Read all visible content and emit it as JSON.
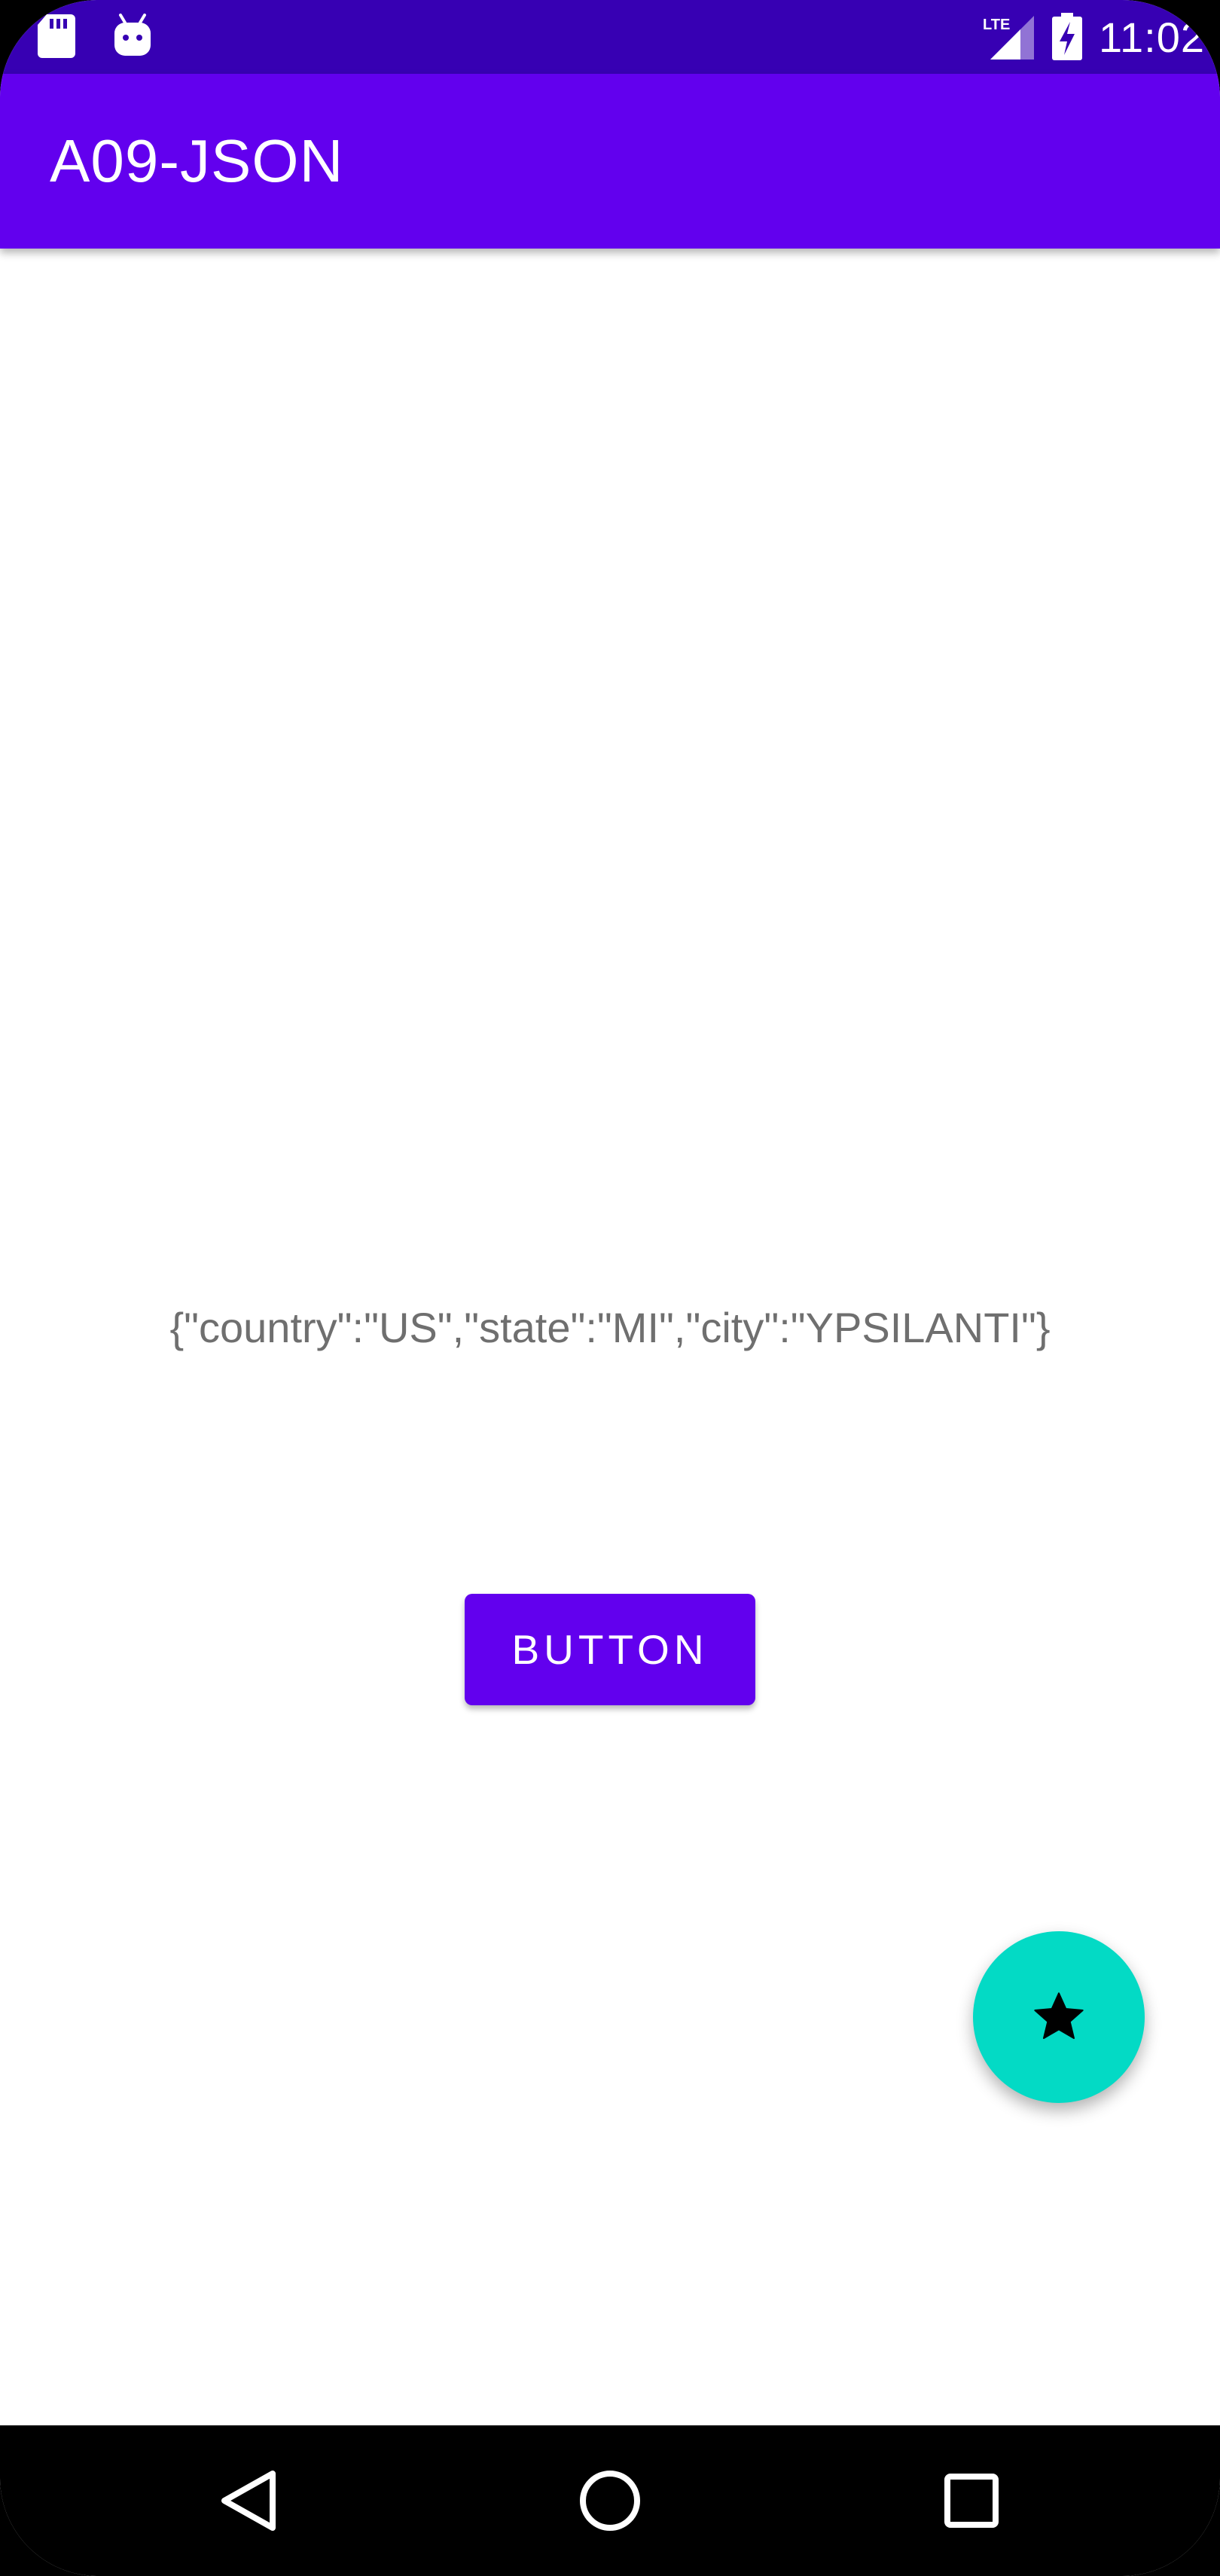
{
  "status_bar": {
    "time": "11:02",
    "icons": [
      "sd-card-icon",
      "android-debug-icon",
      "lte-signal-icon",
      "battery-charging-icon"
    ],
    "network_label": "LTE"
  },
  "app_bar": {
    "title": "A09-JSON"
  },
  "content": {
    "json_text": "{\"country\":\"US\",\"state\":\"MI\",\"city\":\"YPSILANTI\"}",
    "button_label": "BUTTON"
  },
  "fab": {
    "icon": "star-icon"
  },
  "nav_bar": {
    "buttons": [
      "back-icon",
      "home-icon",
      "recents-icon"
    ]
  },
  "colors": {
    "status_bar": "#3700b3",
    "primary": "#6200ee",
    "accent": "#03dac5",
    "text_secondary": "#6f6f6f"
  }
}
